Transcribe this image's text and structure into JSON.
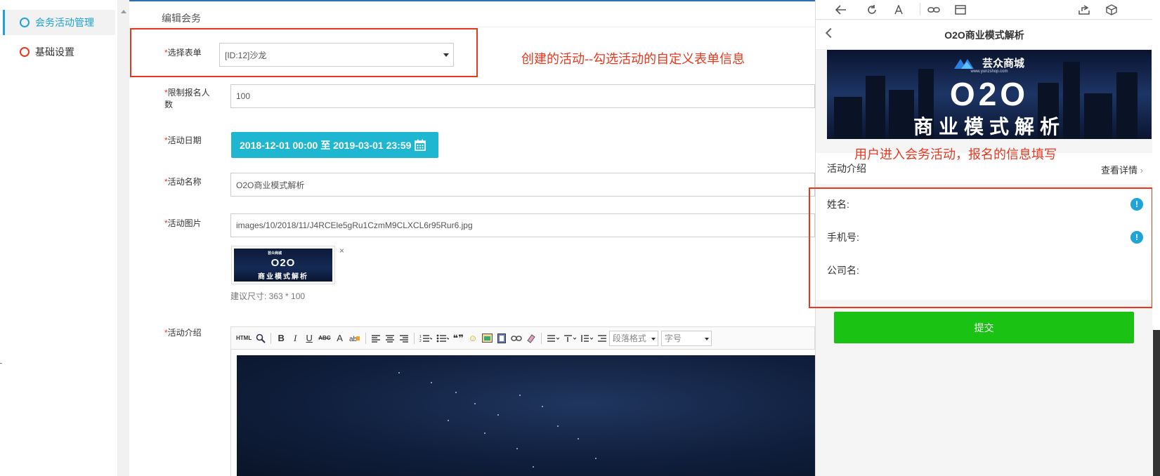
{
  "sidebar": {
    "items": [
      {
        "label": "会务活动管理",
        "active": true
      },
      {
        "label": "基础设置",
        "active": false
      }
    ]
  },
  "main": {
    "page_title": "编辑会务",
    "fields": {
      "form_select": {
        "label": "选择表单",
        "value": "[ID:12]沙龙"
      },
      "limit": {
        "label": "限制报名人数",
        "value": "100"
      },
      "date": {
        "label": "活动日期",
        "value": "2018-12-01 00:00 至 2019-03-01 23:59"
      },
      "name": {
        "label": "活动名称",
        "value": "O2O商业模式解析"
      },
      "image": {
        "label": "活动图片",
        "value": "images/10/2018/11/J4RCEle5gRu1CzmM9CLXCL6r95Rur6.jpg",
        "remove": "×",
        "hint": "建议尺寸: 363 * 100",
        "thumb": {
          "logo": "芸众商城",
          "big": "O2O",
          "sub": "商业模式解析"
        }
      },
      "intro": {
        "label": "活动介绍"
      }
    },
    "required_mark": "*",
    "editor_toolbar": {
      "html": "HTML",
      "bold": "B",
      "italic": "I",
      "underline": "U",
      "strike": "ABC",
      "font_color": "A",
      "quote": "❝❞",
      "emoji": "☺",
      "paragraph_select": "段落格式",
      "size_select": "字号"
    }
  },
  "annotations": {
    "left": "创建的活动--勾选活动的自定义表单信息",
    "right": "用户进入会务活动，报名的信息填写"
  },
  "phone": {
    "title": "O2O商业模式解析",
    "banner": {
      "logo": "芸众商城",
      "url": "www.yunzshop.com",
      "big": "O2O",
      "sub": "商业模式解析"
    },
    "intro_label": "活动介绍",
    "intro_link": "查看详情",
    "form": [
      {
        "label": "姓名:",
        "required": true
      },
      {
        "label": "手机号:",
        "required": true
      },
      {
        "label": "公司名:",
        "required": false
      }
    ],
    "required_icon": "!",
    "submit": "提交"
  },
  "colors": {
    "accent": "#1fa3d8",
    "date_button": "#1fb6d2",
    "annotation_red": "#e8371f",
    "submit_green": "#19c213"
  }
}
